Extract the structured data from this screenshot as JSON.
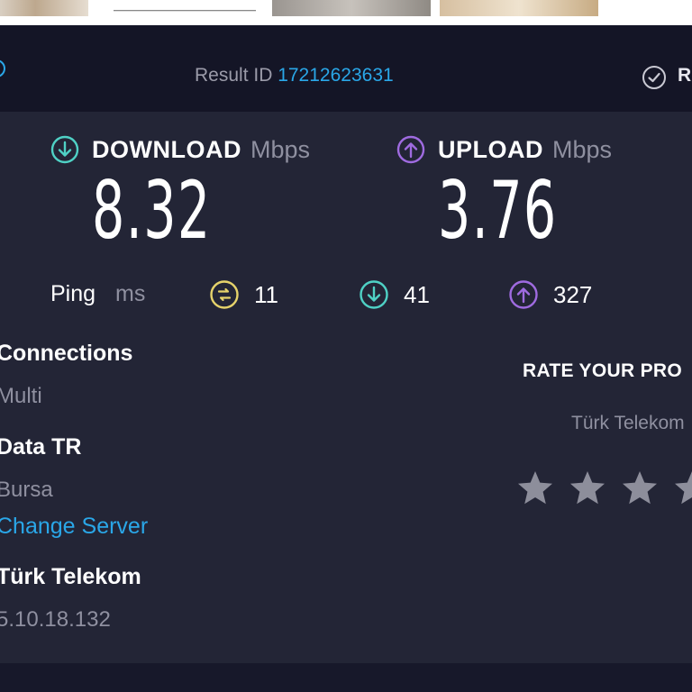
{
  "result": {
    "label": "Result ID ",
    "id": "17212623631",
    "results_label": "R"
  },
  "download": {
    "name": "DOWNLOAD",
    "unit": "Mbps",
    "value": "8.32"
  },
  "upload": {
    "name": "UPLOAD",
    "unit": "Mbps",
    "value": "3.76"
  },
  "ping": {
    "label": "Ping",
    "unit": "ms",
    "idle": "11",
    "download": "41",
    "upload": "327"
  },
  "connections": {
    "title": "Connections",
    "value": "Multi"
  },
  "server": {
    "name": "Data TR",
    "location": "Bursa",
    "change_label": "Change Server"
  },
  "isp": {
    "name": "Türk Telekom",
    "ip": "5.10.18.132"
  },
  "rating": {
    "title": "RATE YOUR PRO",
    "provider": "Türk Telekom",
    "stars_total": 4
  },
  "icons": {
    "download": "download-arrow-icon",
    "upload": "upload-arrow-icon",
    "idle_ping": "idle-ping-icon",
    "results": "check-circle-icon",
    "star": "star-icon"
  },
  "colors": {
    "accent_blue": "#2aa7e8",
    "download_cyan": "#4fd1c5",
    "upload_purple": "#9f6be0",
    "idle_yellow": "#e6d36b",
    "background": "#232536"
  }
}
